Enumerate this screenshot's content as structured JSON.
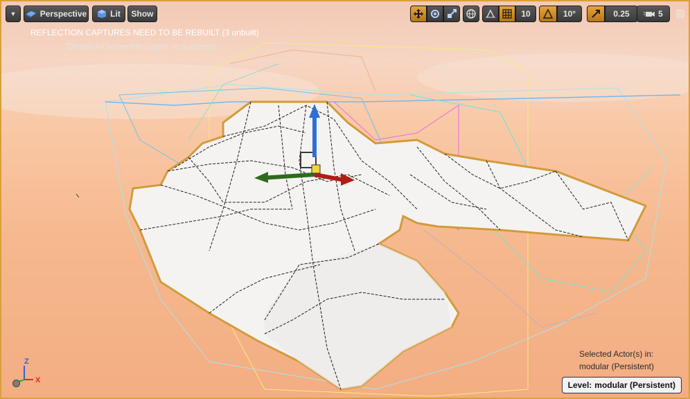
{
  "toolbar": {
    "menu_caret": "▼",
    "perspective_label": "Perspective",
    "lit_label": "Lit",
    "show_label": "Show",
    "grid_snap_value": "10",
    "rotation_snap_value": "10°",
    "scale_snap_value": "0.25",
    "camera_speed_value": "5",
    "icons": [
      "translate-icon",
      "rotate-icon",
      "scale-icon",
      "world-local-icon",
      "surface-snap-icon",
      "grid-icon",
      "angle-icon",
      "scale-snap-icon",
      "camera-speed-icon",
      "maximize-icon"
    ],
    "accent_color": "#e59a2c"
  },
  "messages": {
    "warning": "REFLECTION CAPTURES NEED TO BE REBUILT (3 unbuilt)",
    "suppress": "'DisableAllScreenMessages' to suppress"
  },
  "actor_info": {
    "line1": "Selected Actor(s) in:",
    "line2": "modular (Persistent)"
  },
  "level": {
    "label": "Level:",
    "value": "modular (Persistent)"
  },
  "axis_gizmo": {
    "z": "Z",
    "x": "X"
  }
}
